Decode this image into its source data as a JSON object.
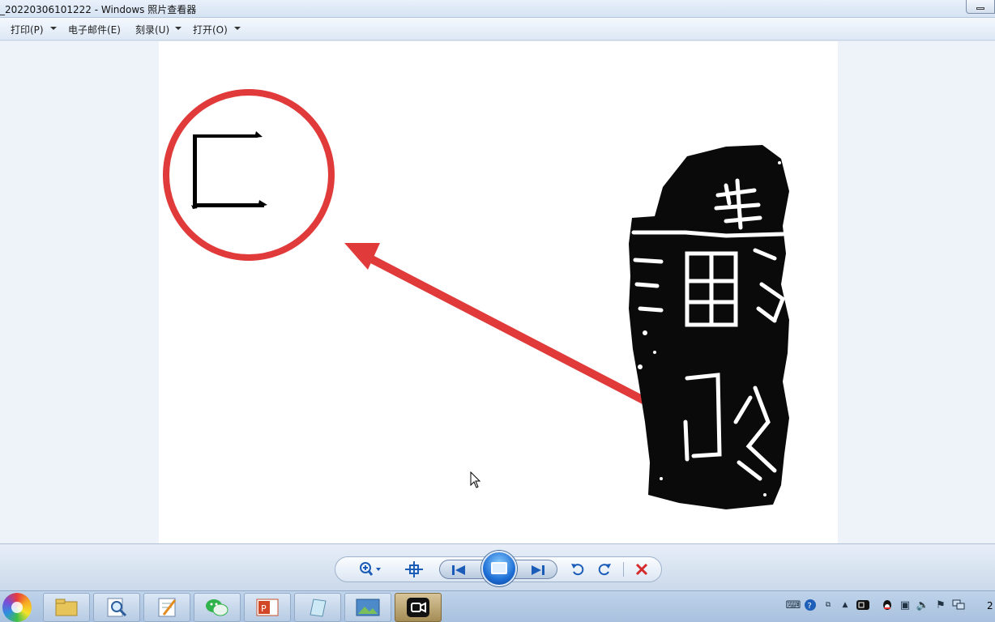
{
  "window": {
    "title": "_20220306101222 - Windows 照片查看器"
  },
  "menu": {
    "items": [
      {
        "label": "打印(P)",
        "has_arrow": true
      },
      {
        "label": "电子邮件(E)",
        "has_arrow": false
      },
      {
        "label": "刻录(U)",
        "has_arrow": true
      },
      {
        "label": "打开(O)",
        "has_arrow": true
      }
    ]
  },
  "viewer_toolbar": {
    "buttons": [
      "zoom-icon",
      "actual-size-icon",
      "previous-icon",
      "slideshow-icon",
      "next-icon",
      "rotate-left-icon",
      "rotate-right-icon",
      "delete-icon"
    ],
    "colors": {
      "delete": "#d32b2b",
      "nav": "#1a5cb8"
    }
  },
  "photo": {
    "annotation_color": "#e03a3a",
    "glyph": "匚"
  },
  "taskbar": {
    "apps": [
      "start-orb",
      "file-explorer",
      "search-tool",
      "notepad",
      "wechat",
      "powerpoint",
      "notes",
      "photo-viewer",
      "video-recorder"
    ],
    "clock": "2"
  }
}
